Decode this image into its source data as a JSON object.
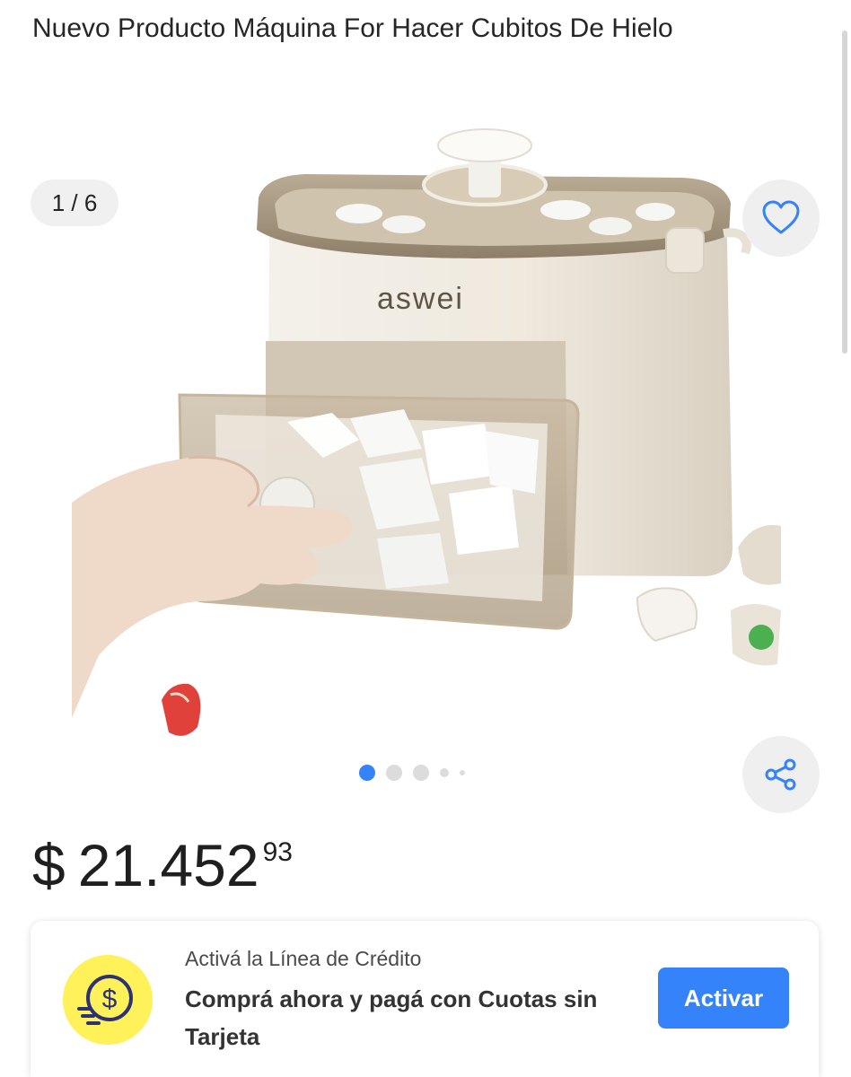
{
  "product": {
    "title": "Nuevo Producto Máquina For Hacer Cubitos De Hielo",
    "brand_on_image": "aswei"
  },
  "gallery": {
    "counter": "1 / 6",
    "current_image": 1,
    "total_images": 6,
    "favorite_icon": "heart-outline-icon",
    "share_icon": "share-icon",
    "dots_visible": 5,
    "active_dot": 0
  },
  "price": {
    "currency": "$",
    "amount": "21.452",
    "cents": "93"
  },
  "credit": {
    "eyebrow": "Activá la Línea de Crédito",
    "headline": "Comprá ahora y pagá con Cuotas sin Tarjeta",
    "button_label": "Activar",
    "icon": "coin-dollar-icon"
  },
  "colors": {
    "accent": "#3483fa",
    "coin": "#fff159",
    "button_bg": "#efefef",
    "text": "#262626"
  }
}
